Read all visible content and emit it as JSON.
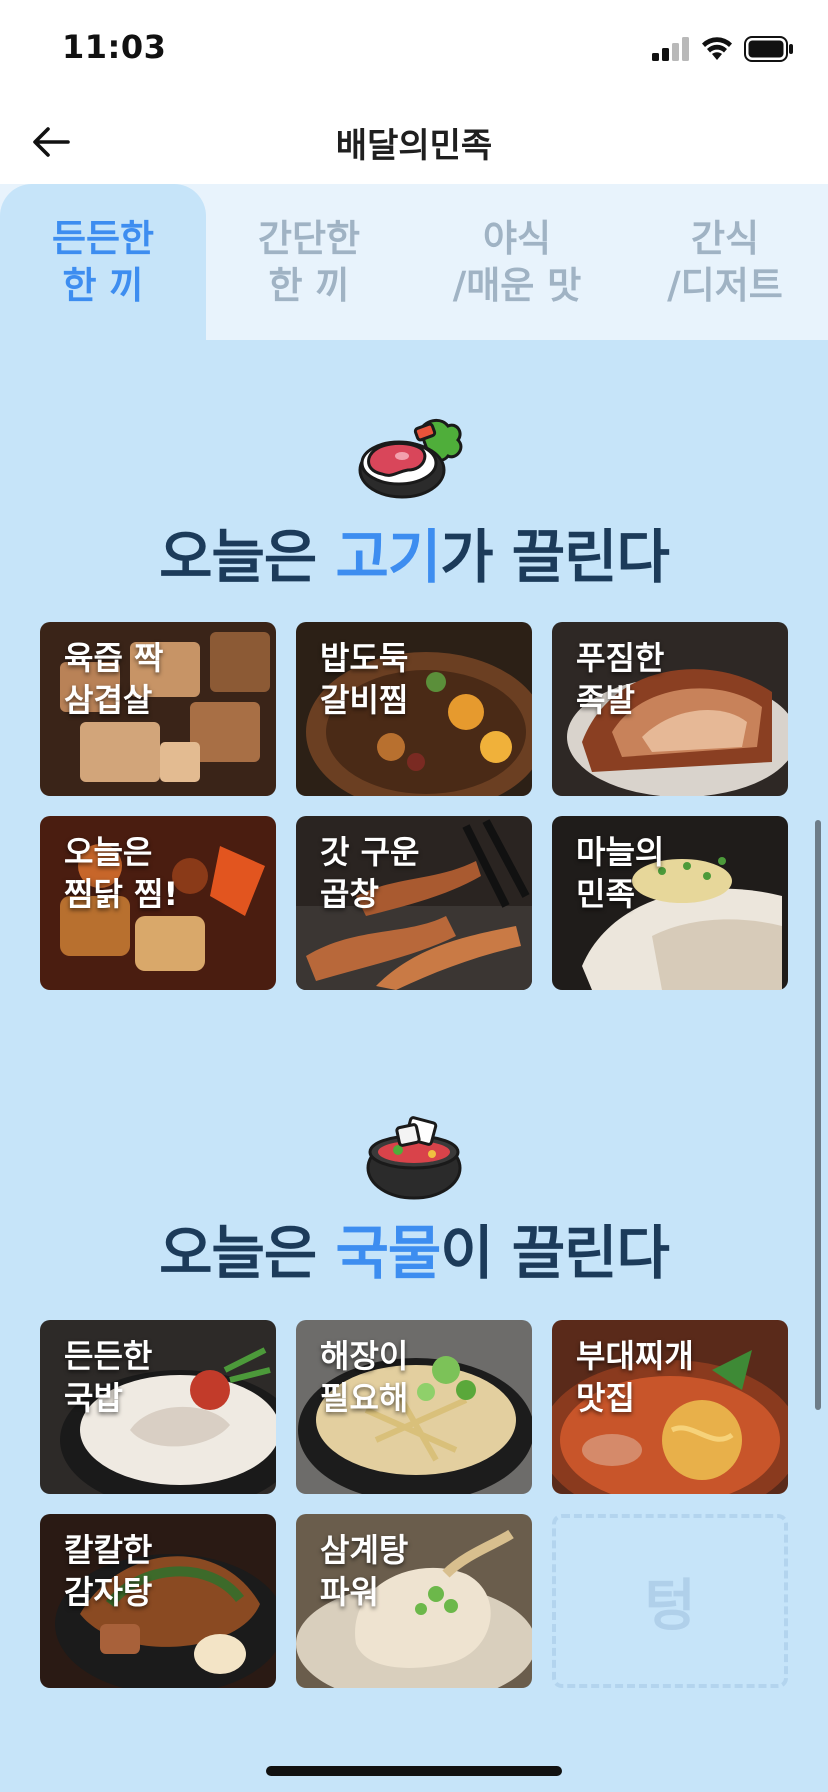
{
  "status_bar": {
    "time": "11:03"
  },
  "nav": {
    "title": "배달의민족"
  },
  "tabs": [
    {
      "label": "든든한\n한 끼",
      "active": true
    },
    {
      "label": "간단한\n한 끼",
      "active": false
    },
    {
      "label": "야식\n/매운 맛",
      "active": false
    },
    {
      "label": "간식\n/디저트",
      "active": false
    }
  ],
  "sections": [
    {
      "title_prefix": "오늘은 ",
      "title_highlight": "고기",
      "title_suffix": "가 끌린다",
      "icon": "steak-icon",
      "cards": [
        {
          "label": "육즙 짝\n삼겹살"
        },
        {
          "label": "밥도둑\n갈비찜"
        },
        {
          "label": "푸짐한\n족발"
        },
        {
          "label": "오늘은\n찜닭 찜!"
        },
        {
          "label": "갓 구운\n곱창"
        },
        {
          "label": "마늘의\n민족"
        }
      ]
    },
    {
      "title_prefix": "오늘은 ",
      "title_highlight": "국물",
      "title_suffix": "이 끌린다",
      "icon": "stew-pot-icon",
      "cards": [
        {
          "label": "든든한\n국밥"
        },
        {
          "label": "해장이\n필요해"
        },
        {
          "label": "부대찌개\n맛집"
        },
        {
          "label": "칼칼한\n감자탕"
        },
        {
          "label": "삼계탕\n파워"
        }
      ],
      "empty_card_text": "텅"
    }
  ],
  "colors": {
    "accent": "#3d8df0",
    "title": "#1c3b5a",
    "background": "#c6e4f9",
    "tab_inactive": "#a0b3c4"
  }
}
